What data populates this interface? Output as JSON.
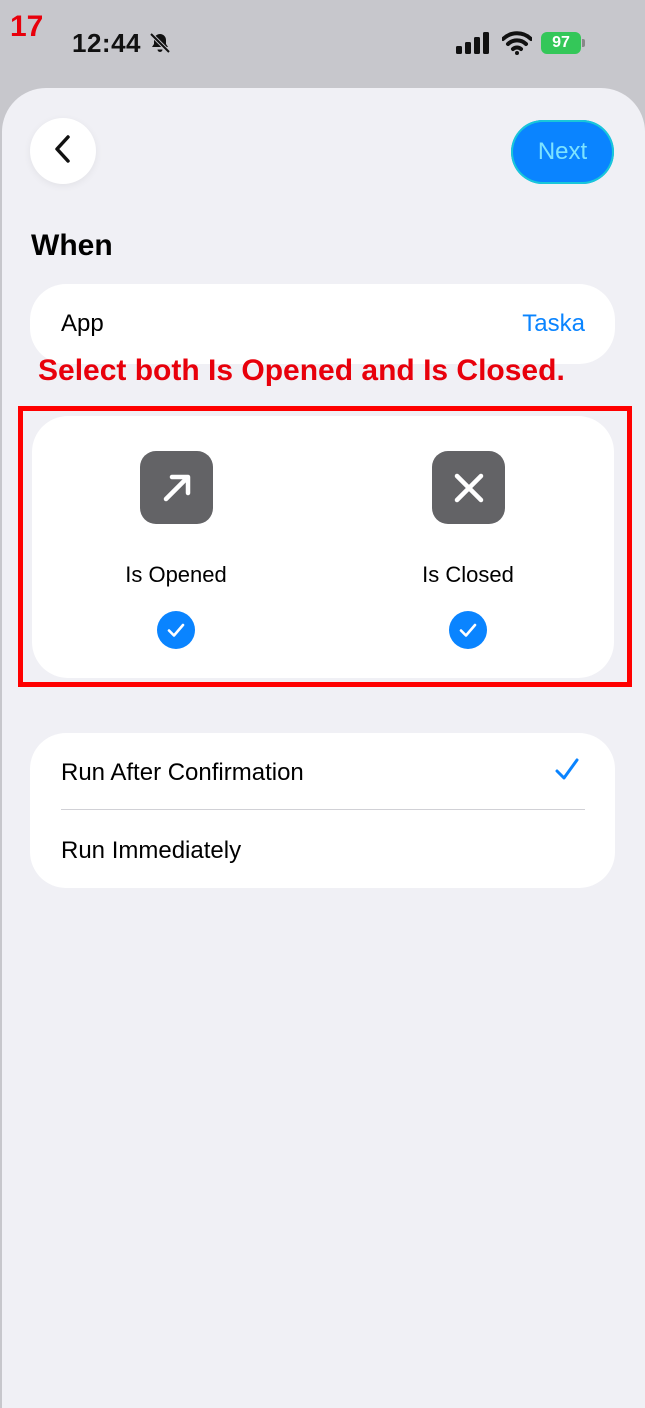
{
  "overlay": {
    "step_number": "17",
    "instruction": "Select both Is Opened and Is Closed."
  },
  "status_bar": {
    "time": "12:44",
    "battery": "97",
    "icons": [
      "bell-slash-icon",
      "cellular-signal-icon",
      "wifi-icon",
      "battery-icon"
    ]
  },
  "nav": {
    "back_icon": "chevron-left-icon",
    "next_label": "Next"
  },
  "section": {
    "title": "When"
  },
  "app_row": {
    "label": "App",
    "value": "Taska"
  },
  "triggers": [
    {
      "label": "Is Opened",
      "icon": "arrow-up-right-icon",
      "selected": true
    },
    {
      "label": "Is Closed",
      "icon": "xmark-icon",
      "selected": true
    }
  ],
  "run_options": [
    {
      "label": "Run After Confirmation",
      "selected": true
    },
    {
      "label": "Run Immediately",
      "selected": false
    }
  ],
  "colors": {
    "accent": "#0a84ff",
    "annotation": "#e8000b",
    "background": "#f0f0f5",
    "icon_tile": "#636366",
    "battery": "#34c759"
  }
}
